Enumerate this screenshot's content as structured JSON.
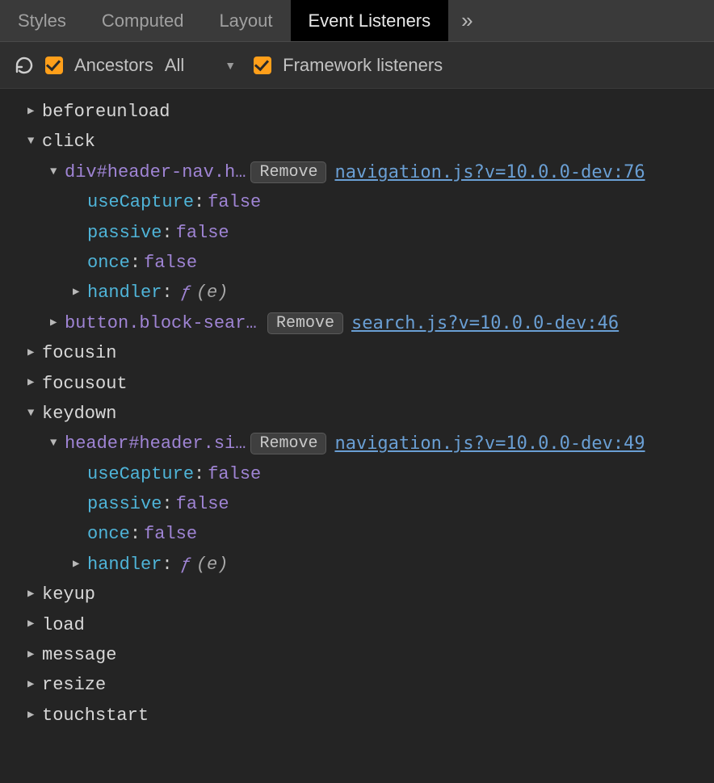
{
  "tabs": {
    "items": [
      "Styles",
      "Computed",
      "Layout",
      "Event Listeners"
    ],
    "active": 3,
    "overflow": "»"
  },
  "toolbar": {
    "ancestors_label": "Ancestors",
    "filter_label": "All",
    "framework_label": "Framework listeners"
  },
  "remove_label": "Remove",
  "events": [
    {
      "name": "beforeunload",
      "expanded": false
    },
    {
      "name": "click",
      "expanded": true,
      "listeners": [
        {
          "selector": "div#header-nav.h…",
          "link": "navigation.js?v=10.0.0-dev:76",
          "expanded": true,
          "props": [
            {
              "key": "useCapture",
              "val": "false"
            },
            {
              "key": "passive",
              "val": "false"
            },
            {
              "key": "once",
              "val": "false"
            }
          ],
          "handler": {
            "key": "handler",
            "fn": "ƒ",
            "args": "(e)"
          }
        },
        {
          "selector": "button.block-search-…",
          "link": "search.js?v=10.0.0-dev:46",
          "expanded": false
        }
      ]
    },
    {
      "name": "focusin",
      "expanded": false
    },
    {
      "name": "focusout",
      "expanded": false
    },
    {
      "name": "keydown",
      "expanded": true,
      "listeners": [
        {
          "selector": "header#header.si…",
          "link": "navigation.js?v=10.0.0-dev:49",
          "expanded": true,
          "props": [
            {
              "key": "useCapture",
              "val": "false"
            },
            {
              "key": "passive",
              "val": "false"
            },
            {
              "key": "once",
              "val": "false"
            }
          ],
          "handler": {
            "key": "handler",
            "fn": "ƒ",
            "args": "(e)"
          }
        }
      ]
    },
    {
      "name": "keyup",
      "expanded": false
    },
    {
      "name": "load",
      "expanded": false
    },
    {
      "name": "message",
      "expanded": false
    },
    {
      "name": "resize",
      "expanded": false
    },
    {
      "name": "touchstart",
      "expanded": false
    }
  ]
}
